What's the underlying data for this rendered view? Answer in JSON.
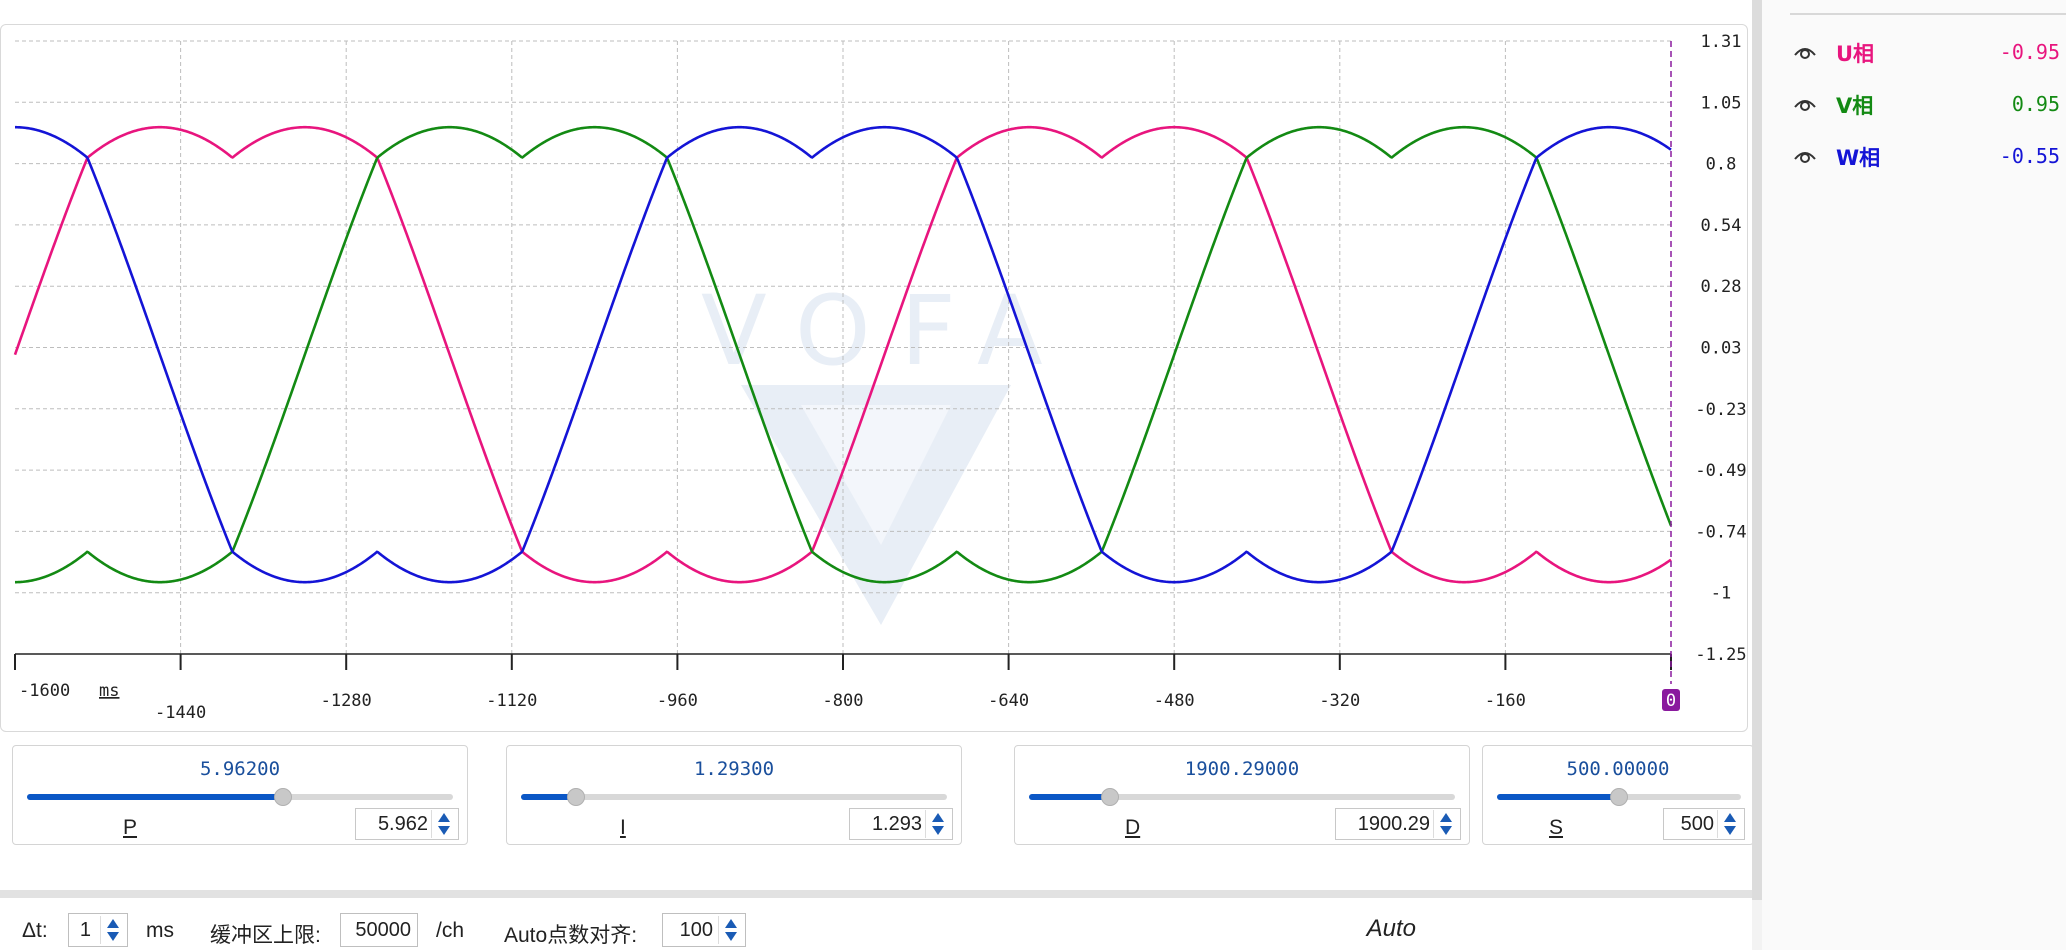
{
  "colors": {
    "u": "#e8157e",
    "v": "#138a13",
    "w": "#1414d6",
    "accent": "#0b57c6",
    "cursor": "#8a1a9e"
  },
  "watermark": "VOFA",
  "chart_data": {
    "type": "line",
    "x_unit": "ms",
    "xlim": [
      -1600,
      0
    ],
    "ylim": [
      -1.25,
      1.31
    ],
    "x_ticks": [
      "-1600",
      "-1440",
      "-1280",
      "-1120",
      "-960",
      "-800",
      "-640",
      "-480",
      "-320",
      "-160",
      "0"
    ],
    "y_ticks": [
      "1.31",
      "1.05",
      "0.8",
      "0.54",
      "0.28",
      "0.03",
      "-0.23",
      "-0.49",
      "-0.74",
      "-1",
      "-1.25"
    ],
    "period_ms": 840,
    "amplitude": 0.95,
    "series": [
      {
        "name": "U相",
        "color": "#e8157e",
        "phase_deg": 0
      },
      {
        "name": "V相",
        "color": "#138a13",
        "phase_deg": -120
      },
      {
        "name": "W相",
        "color": "#1414d6",
        "phase_deg": 120
      }
    ]
  },
  "legend": [
    {
      "name": "U相",
      "value": "-0.95",
      "color": "#e8157e",
      "icon": "eye-icon"
    },
    {
      "name": "V相",
      "value": "0.95",
      "color": "#138a13",
      "icon": "eye-icon"
    },
    {
      "name": "W相",
      "value": "-0.55",
      "color": "#1414d6",
      "icon": "eye-icon"
    }
  ],
  "params": [
    {
      "name": "P",
      "value": "5.96200",
      "input": "5.962",
      "fraction": 0.6
    },
    {
      "name": "I",
      "value": "1.29300",
      "input": "1.293",
      "fraction": 0.13
    },
    {
      "name": "D",
      "value": "1900.29000",
      "input": "1900.29",
      "fraction": 0.19
    },
    {
      "name": "S",
      "value": "500.00000",
      "input": "500",
      "fraction": 0.5
    }
  ],
  "bottom": {
    "dt_label": "Δt:",
    "dt_value": "1",
    "dt_unit": "ms",
    "buffer_label": "缓冲区上限:",
    "buffer_value": "50000",
    "buffer_unit": "/ch",
    "align_label": "Auto点数对齐:",
    "align_value": "100",
    "auto_label": "Auto"
  }
}
